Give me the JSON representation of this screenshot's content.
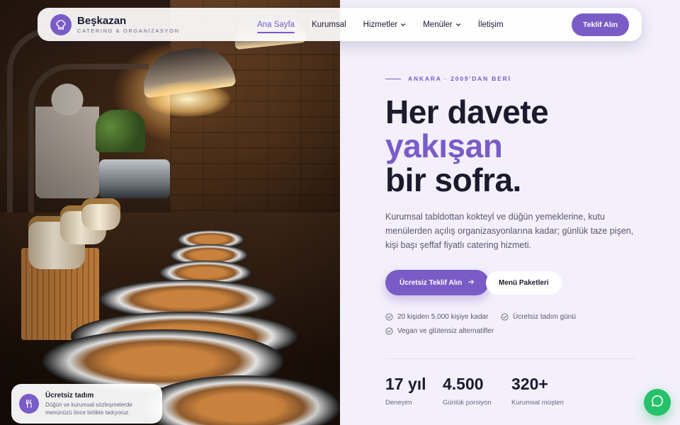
{
  "brand": {
    "name": "Beşkazan",
    "tagline": "CATERING & ORGANİZASYON",
    "logo_icon": "chef-hat-icon"
  },
  "nav": {
    "items": [
      {
        "label": "Ana Sayfa",
        "active": true,
        "dropdown": false
      },
      {
        "label": "Kurumsal",
        "active": false,
        "dropdown": false
      },
      {
        "label": "Hizmetler",
        "active": false,
        "dropdown": true
      },
      {
        "label": "Menüler",
        "active": false,
        "dropdown": true
      },
      {
        "label": "İletişim",
        "active": false,
        "dropdown": false
      }
    ],
    "cta_label": "Teklif Alın"
  },
  "hero": {
    "eyebrow": "ANKARA · 2009'DAN BERİ",
    "headline_line1": "Her davete",
    "headline_accent": "yakışan",
    "headline_line3": "bir sofra.",
    "lead": "Kurumsal tabldottan kokteyl ve düğün yemeklerine, kutu menülerden açılış organizasyonlarına kadar; günlük taze pişen, kişi başı şeffaf fiyatlı catering hizmeti.",
    "primary_cta": "Ücretsiz Teklif Alın",
    "secondary_cta": "Menü Paketleri",
    "features": [
      "20 kişiden 5.000 kişiye kadar",
      "Ücretsiz tadım günü",
      "Vegan ve glütensiz alternatifler"
    ],
    "stats": [
      {
        "value": "17 yıl",
        "label": "Deneyim"
      },
      {
        "value": "4.500",
        "label": "Günlük porsiyon"
      },
      {
        "value": "320+",
        "label": "Kurumsal müşteri"
      }
    ]
  },
  "tasting_card": {
    "title": "Ücretsiz tadım",
    "description": "Düğün ve kurumsal sözleşmelerde menünüzü önce birlikte tadıyoruz.",
    "icon": "utensils-icon"
  },
  "chat": {
    "icon": "whatsapp-icon"
  },
  "colors": {
    "accent": "#7a5cc7",
    "dark": "#1d1a2e",
    "background": "#f3f0fb",
    "whatsapp": "#25c26a"
  }
}
